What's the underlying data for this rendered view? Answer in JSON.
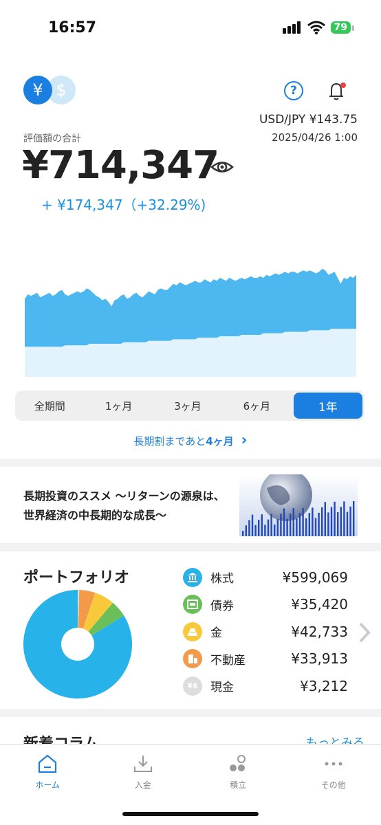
{
  "status_bar": {
    "time": "16:57",
    "battery": "79"
  },
  "header": {
    "currency_yen": "¥",
    "currency_usd": "$",
    "help": "?",
    "fx_rate": "USD/JPY ¥143.75",
    "fx_date": "2025/04/26 1:00"
  },
  "summary": {
    "label": "評価額の合計",
    "total": "¥714,347",
    "change": "+ ¥174,347（+32.29%)"
  },
  "chart_data": {
    "type": "area",
    "series": [
      {
        "values": [
          52,
          55,
          54,
          55,
          56,
          53,
          54,
          55,
          56,
          54,
          55,
          57,
          58,
          55,
          54,
          55,
          56,
          57,
          56,
          57,
          59,
          58,
          56,
          54,
          53,
          51,
          52,
          50,
          47,
          51,
          52,
          54,
          55,
          52,
          53,
          55,
          56,
          54,
          53,
          55,
          57,
          56,
          55,
          58,
          59,
          58,
          58,
          60,
          62,
          61,
          63,
          62,
          61,
          62,
          63,
          64,
          63,
          63,
          65,
          64,
          63,
          65,
          64,
          66,
          65,
          64,
          66,
          65,
          64,
          65,
          66,
          65,
          66,
          67,
          66,
          66,
          67,
          66,
          68,
          67,
          68,
          69,
          68,
          69,
          70,
          69,
          70,
          70,
          69,
          70,
          71,
          70,
          71,
          70,
          69,
          70,
          72,
          71,
          68,
          69,
          70,
          66,
          62,
          66,
          65,
          67,
          66,
          68
        ]
      },
      {
        "values": [
          20,
          20,
          20,
          20,
          20,
          20,
          20,
          20,
          20,
          20,
          20,
          20,
          20,
          21,
          21,
          21,
          21,
          21,
          21,
          21,
          21,
          22,
          22,
          22,
          22,
          22,
          22,
          22,
          22,
          22,
          22,
          22,
          23,
          23,
          23,
          23,
          23,
          23,
          23,
          23,
          24,
          24,
          24,
          24,
          24,
          24,
          24,
          24,
          25,
          25,
          25,
          25,
          25,
          25,
          25,
          25,
          26,
          26,
          26,
          26,
          26,
          26,
          26,
          27,
          27,
          27,
          27,
          27,
          27,
          27,
          28,
          28,
          28,
          28,
          28,
          28,
          28,
          29,
          29,
          29,
          29,
          29,
          29,
          29,
          30,
          30,
          30,
          30,
          30,
          30,
          30,
          30,
          31,
          31,
          31,
          31,
          31,
          31,
          31,
          32,
          32,
          32,
          32,
          32,
          32,
          32,
          32,
          32
        ]
      }
    ],
    "colors": [
      "#4db8f0",
      "#e3f3fd"
    ]
  },
  "periods": {
    "all": "全期間",
    "m1": "1ヶ月",
    "m3": "3ヶ月",
    "m6": "6ヶ月",
    "y1": "1年",
    "selected": "1年"
  },
  "long_term": {
    "prefix": "長期割まであと",
    "count": "4ヶ月",
    "chevron": "›"
  },
  "banner": {
    "text": "長期投資のススメ 〜リターンの源泉は、世界経済の中長期的な成長〜"
  },
  "portfolio": {
    "title": "ポートフォリオ",
    "items": [
      {
        "label": "株式",
        "value": "¥599,069",
        "amount": 599069,
        "color": "#27b3ea",
        "icon": "bank-icon"
      },
      {
        "label": "債券",
        "value": "¥35,420",
        "amount": 35420,
        "color": "#6bbf59",
        "icon": "bond-icon"
      },
      {
        "label": "金",
        "value": "¥42,733",
        "amount": 42733,
        "color": "#f8c93a",
        "icon": "gold-icon"
      },
      {
        "label": "不動産",
        "value": "¥33,913",
        "amount": 33913,
        "color": "#f39a4a",
        "icon": "building-icon"
      },
      {
        "label": "現金",
        "value": "¥3,212",
        "amount": 3212,
        "color": "#dddddd",
        "icon": "cash-icon"
      }
    ]
  },
  "column": {
    "title": "新着コラム",
    "more": "もっとみる"
  },
  "tabs": {
    "home": "ホーム",
    "deposit": "入金",
    "saving": "積立",
    "other": "その他"
  }
}
